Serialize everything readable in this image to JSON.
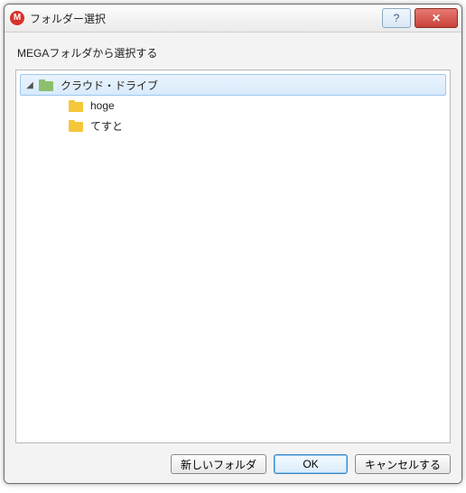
{
  "titlebar": {
    "app_icon_letter": "M",
    "title": "フォルダー選択",
    "help_glyph": "?",
    "close_glyph": "✕"
  },
  "subtitle": "MEGAフォルダから選択する",
  "tree": {
    "root": {
      "label": "クラウド・ドライブ",
      "expanded_glyph": "◢",
      "children": [
        {
          "label": "hoge"
        },
        {
          "label": "てすと"
        }
      ]
    }
  },
  "buttons": {
    "new_folder": "新しいフォルダ",
    "ok": "OK",
    "cancel": "キャンセルする"
  }
}
